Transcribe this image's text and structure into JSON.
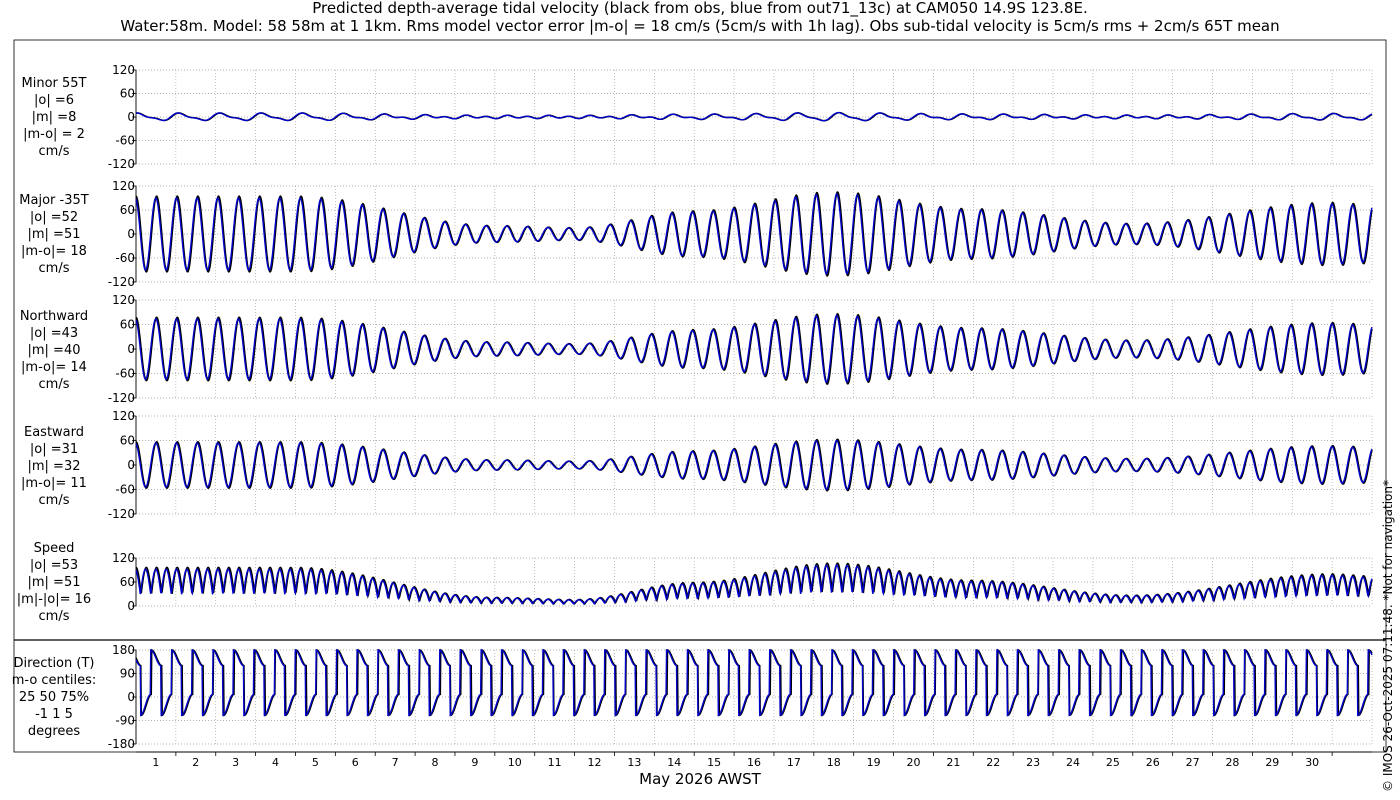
{
  "figure": {
    "title_line1": "Predicted depth-average tidal velocity (black from obs, blue from out71_13c) at CAM050 14.9S 123.8E.",
    "title_line2": "Water:58m. Model: 58 58m at 1 1km. Rms model vector error |m-o| = 18 cm/s (5cm/s with 1h lag). Obs sub-tidal velocity is 5cm/s rms + 2cm/s 65T mean",
    "xlabel": "May 2026 AWST",
    "copyright": "© IMOS 26-Oct-2025 07:11:48. *Not for navigation*",
    "colors": {
      "obs": "#000000",
      "model": "#0000cd",
      "grid": "#999999"
    }
  },
  "panels": [
    {
      "id": "minor",
      "label": "Minor 55T\n|o| =6\n|m| =8\n|m-o| = 2\ncm/s"
    },
    {
      "id": "major",
      "label": "Major -35T\n|o| =52\n|m| =51\n|m-o|= 18\ncm/s"
    },
    {
      "id": "north",
      "label": "Northward\n|o| =43\n|m| =40\n|m-o|= 14\ncm/s"
    },
    {
      "id": "east",
      "label": "Eastward\n|o| =31\n|m| =32\n|m-o|= 11\ncm/s"
    },
    {
      "id": "speed",
      "label": "Speed\n|o| =53\n|m| =51\n|m|-|o|= 16\ncm/s"
    },
    {
      "id": "dir",
      "label": "Direction (T)\nm-o centiles:\n25  50  75%\n-1  1  5\ndegrees"
    }
  ],
  "chart_data": {
    "type": "line",
    "series": [
      {
        "name": "obs",
        "color": "#000000"
      },
      {
        "name": "model",
        "color": "#0000cd"
      }
    ],
    "x": {
      "label": "May 2026 AWST",
      "min": 0,
      "max": 31,
      "ticks": [
        "1",
        "2",
        "3",
        "4",
        "5",
        "6",
        "7",
        "8",
        "9",
        "10",
        "11",
        "12",
        "13",
        "14",
        "15",
        "16",
        "17",
        "18",
        "19",
        "20",
        "21",
        "22",
        "23",
        "24",
        "25",
        "26",
        "27",
        "28",
        "29",
        "30"
      ]
    },
    "tidal_period_hours": 12.42,
    "spring_neap_amplitude_by_day": {
      "days": [
        0,
        4,
        9,
        11,
        14,
        17.5,
        21,
        25,
        30,
        31
      ],
      "major_cm_s": [
        90,
        90,
        20,
        15,
        55,
        100,
        60,
        25,
        75,
        70
      ]
    },
    "panels": [
      {
        "id": "minor",
        "ylabel": "Minor 55T",
        "ylim": [
          -120,
          120
        ],
        "yticks": [
          "120",
          "60",
          "0",
          "-60",
          "-120"
        ],
        "amp_scale": 0.08,
        "obs_rms": 6,
        "model_rms": 8,
        "rms_error": 2
      },
      {
        "id": "major",
        "ylabel": "Major -35T",
        "ylim": [
          -120,
          120
        ],
        "yticks": [
          "120",
          "60",
          "0",
          "-60",
          "-120"
        ],
        "amp_scale": 1.0,
        "obs_rms": 52,
        "model_rms": 51,
        "rms_error": 18
      },
      {
        "id": "north",
        "ylabel": "Northward",
        "ylim": [
          -120,
          120
        ],
        "yticks": [
          "120",
          "60",
          "0",
          "-60",
          "-120"
        ],
        "amp_scale": 0.82,
        "obs_rms": 43,
        "model_rms": 40,
        "rms_error": 14
      },
      {
        "id": "east",
        "ylabel": "Eastward",
        "ylim": [
          -120,
          120
        ],
        "yticks": [
          "120",
          "60",
          "0",
          "-60",
          "-120"
        ],
        "amp_scale": 0.6,
        "obs_rms": 31,
        "model_rms": 32,
        "rms_error": 11
      },
      {
        "id": "speed",
        "ylabel": "Speed",
        "ylim": [
          0,
          120
        ],
        "yticks": [
          "120",
          "60",
          "0"
        ],
        "amp_scale": 1.0,
        "obs_rms": 53,
        "model_rms": 51,
        "rms_error": 16
      },
      {
        "id": "dir",
        "ylabel": "Direction (T)",
        "ylim": [
          -180,
          180
        ],
        "yticks": [
          "180",
          "90",
          "0",
          "-90",
          "-180"
        ],
        "median_error_deg": [
          -1,
          1,
          5
        ]
      }
    ]
  }
}
